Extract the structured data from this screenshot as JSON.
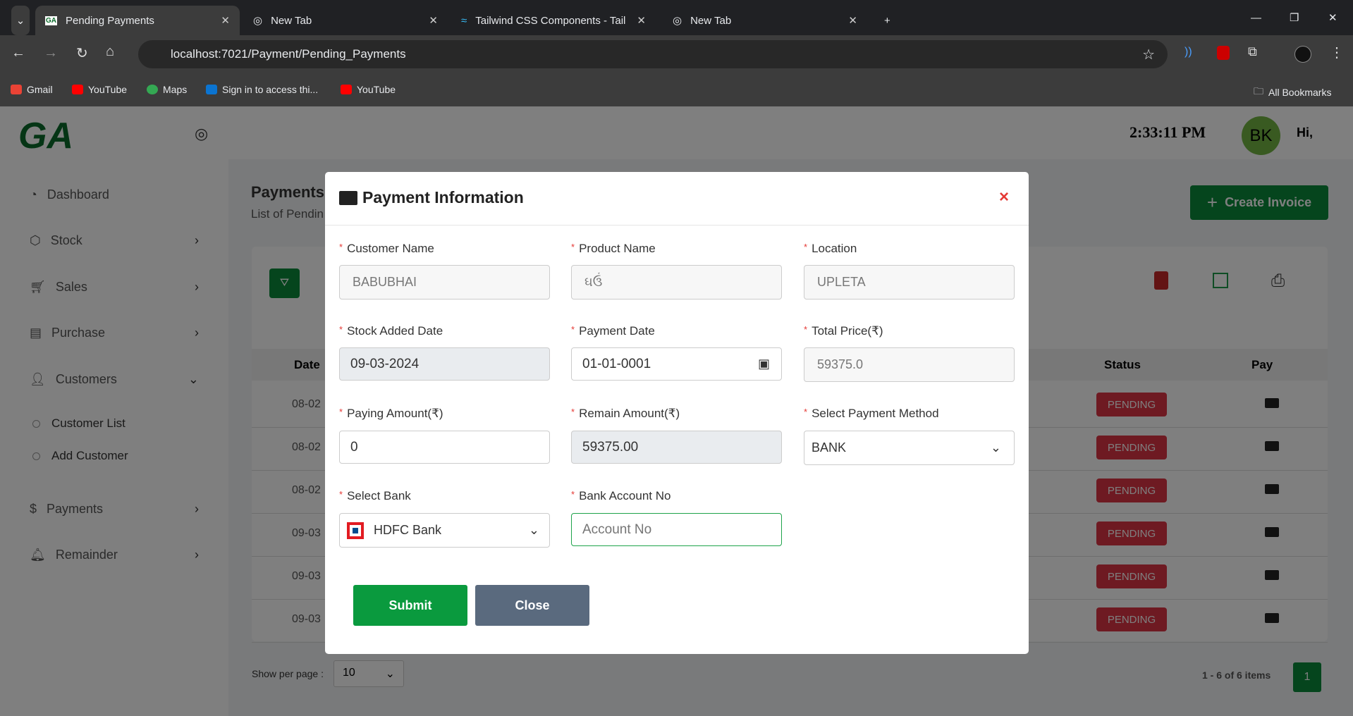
{
  "browser": {
    "tabs": [
      {
        "title": "Pending Payments",
        "active": true
      },
      {
        "title": "New Tab"
      },
      {
        "title": "Tailwind CSS Components - Tail"
      },
      {
        "title": "New Tab"
      }
    ],
    "url": "localhost:7021/Payment/Pending_Payments",
    "bookmarks": [
      "Gmail",
      "YouTube",
      "Maps",
      "Sign in to access thi...",
      "YouTube"
    ],
    "all_bookmarks": "All Bookmarks"
  },
  "app": {
    "logo": "GA",
    "time": "2:33:11 PM",
    "avatar": "BK",
    "greeting": "Hi,",
    "sidebar": {
      "items": [
        {
          "label": "Dashboard",
          "icon": "dashboard-icon"
        },
        {
          "label": "Stock",
          "icon": "box-icon"
        },
        {
          "label": "Sales",
          "icon": "cart-icon"
        },
        {
          "label": "Purchase",
          "icon": "receipt-icon"
        },
        {
          "label": "Customers",
          "icon": "user-icon"
        },
        {
          "label": "Payments",
          "icon": "dollar-icon"
        },
        {
          "label": "Remainder",
          "icon": "bell-icon"
        }
      ],
      "customer_sub": [
        "Customer List",
        "Add Customer"
      ]
    },
    "page": {
      "title": "Payments",
      "subtitle": "List of Pendin",
      "create_invoice": "Create Invoice",
      "columns": {
        "date": "Date",
        "status": "Status",
        "pay": "Pay"
      },
      "rows": [
        {
          "date": "08-02",
          "status": "PENDING"
        },
        {
          "date": "08-02",
          "status": "PENDING"
        },
        {
          "date": "08-02",
          "status": "PENDING"
        },
        {
          "date": "09-03",
          "status": "PENDING"
        },
        {
          "date": "09-03",
          "status": "PENDING"
        },
        {
          "date": "09-03",
          "status": "PENDING"
        }
      ],
      "show_per_page": "Show per page :",
      "per_page": "10",
      "items_info": "1 - 6 of 6 items",
      "current_page": "1"
    }
  },
  "modal": {
    "title": "Payment Information",
    "close_x": "×",
    "fields": {
      "customer_name": {
        "label": "Customer Name",
        "value": "BABUBHAI"
      },
      "product_name": {
        "label": "Product Name",
        "value": "ઘઉં"
      },
      "location": {
        "label": "Location",
        "value": "UPLETA"
      },
      "stock_added_date": {
        "label": "Stock Added Date",
        "value": "09-03-2024"
      },
      "payment_date": {
        "label": "Payment Date",
        "value": "01-01-0001"
      },
      "total_price": {
        "label": "Total Price(₹)",
        "value": "59375.0"
      },
      "paying_amount": {
        "label": "Paying Amount(₹)",
        "value": "0"
      },
      "remain_amount": {
        "label": "Remain Amount(₹)",
        "value": "59375.00"
      },
      "payment_method": {
        "label": "Select Payment Method",
        "value": "BANK"
      },
      "bank": {
        "label": "Select Bank",
        "value": "HDFC Bank"
      },
      "account_no": {
        "label": "Bank Account No",
        "placeholder": "Account No"
      }
    },
    "submit": "Submit",
    "close": "Close"
  },
  "colors": {
    "primary_green": "#0a8a3a",
    "danger": "#dc3545",
    "close_btn": "#5a6a7e"
  }
}
